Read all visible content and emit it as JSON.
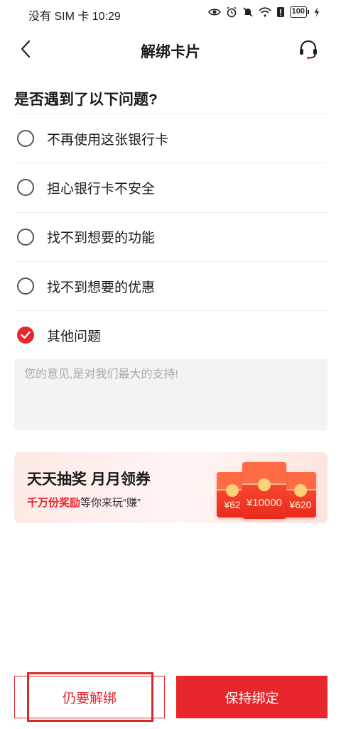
{
  "status_bar": {
    "carrier_time": "没有 SIM 卡 10:29",
    "battery": "100",
    "icons": [
      "eye-icon",
      "alarm-icon",
      "mute-bell-icon",
      "wifi-icon",
      "alert-icon",
      "battery-icon",
      "charging-icon"
    ]
  },
  "nav": {
    "title": "解绑卡片",
    "back_icon": "chevron-left-icon",
    "service_icon": "headset-icon"
  },
  "question": {
    "title": "是否遇到了以下问题?",
    "options": [
      {
        "label": "不再使用这张银行卡",
        "checked": false
      },
      {
        "label": "担心银行卡不安全",
        "checked": false
      },
      {
        "label": "找不到想要的功能",
        "checked": false
      },
      {
        "label": "找不到想要的优惠",
        "checked": false
      },
      {
        "label": "其他问题",
        "checked": true
      }
    ]
  },
  "feedback": {
    "value": "",
    "placeholder": "您的意见,是对我们最大的支持!"
  },
  "promo": {
    "title": "天天抽奖  月月领券",
    "sub_highlight": "千万份奖励",
    "sub_rest": "等你来玩“赚”",
    "envelopes": [
      "¥62",
      "¥10000",
      "¥620"
    ]
  },
  "actions": {
    "unbind_label": "仍要解绑",
    "keep_label": "保持绑定"
  },
  "colors": {
    "accent": "#e8262d",
    "annotation_box": "#d52b2b"
  }
}
